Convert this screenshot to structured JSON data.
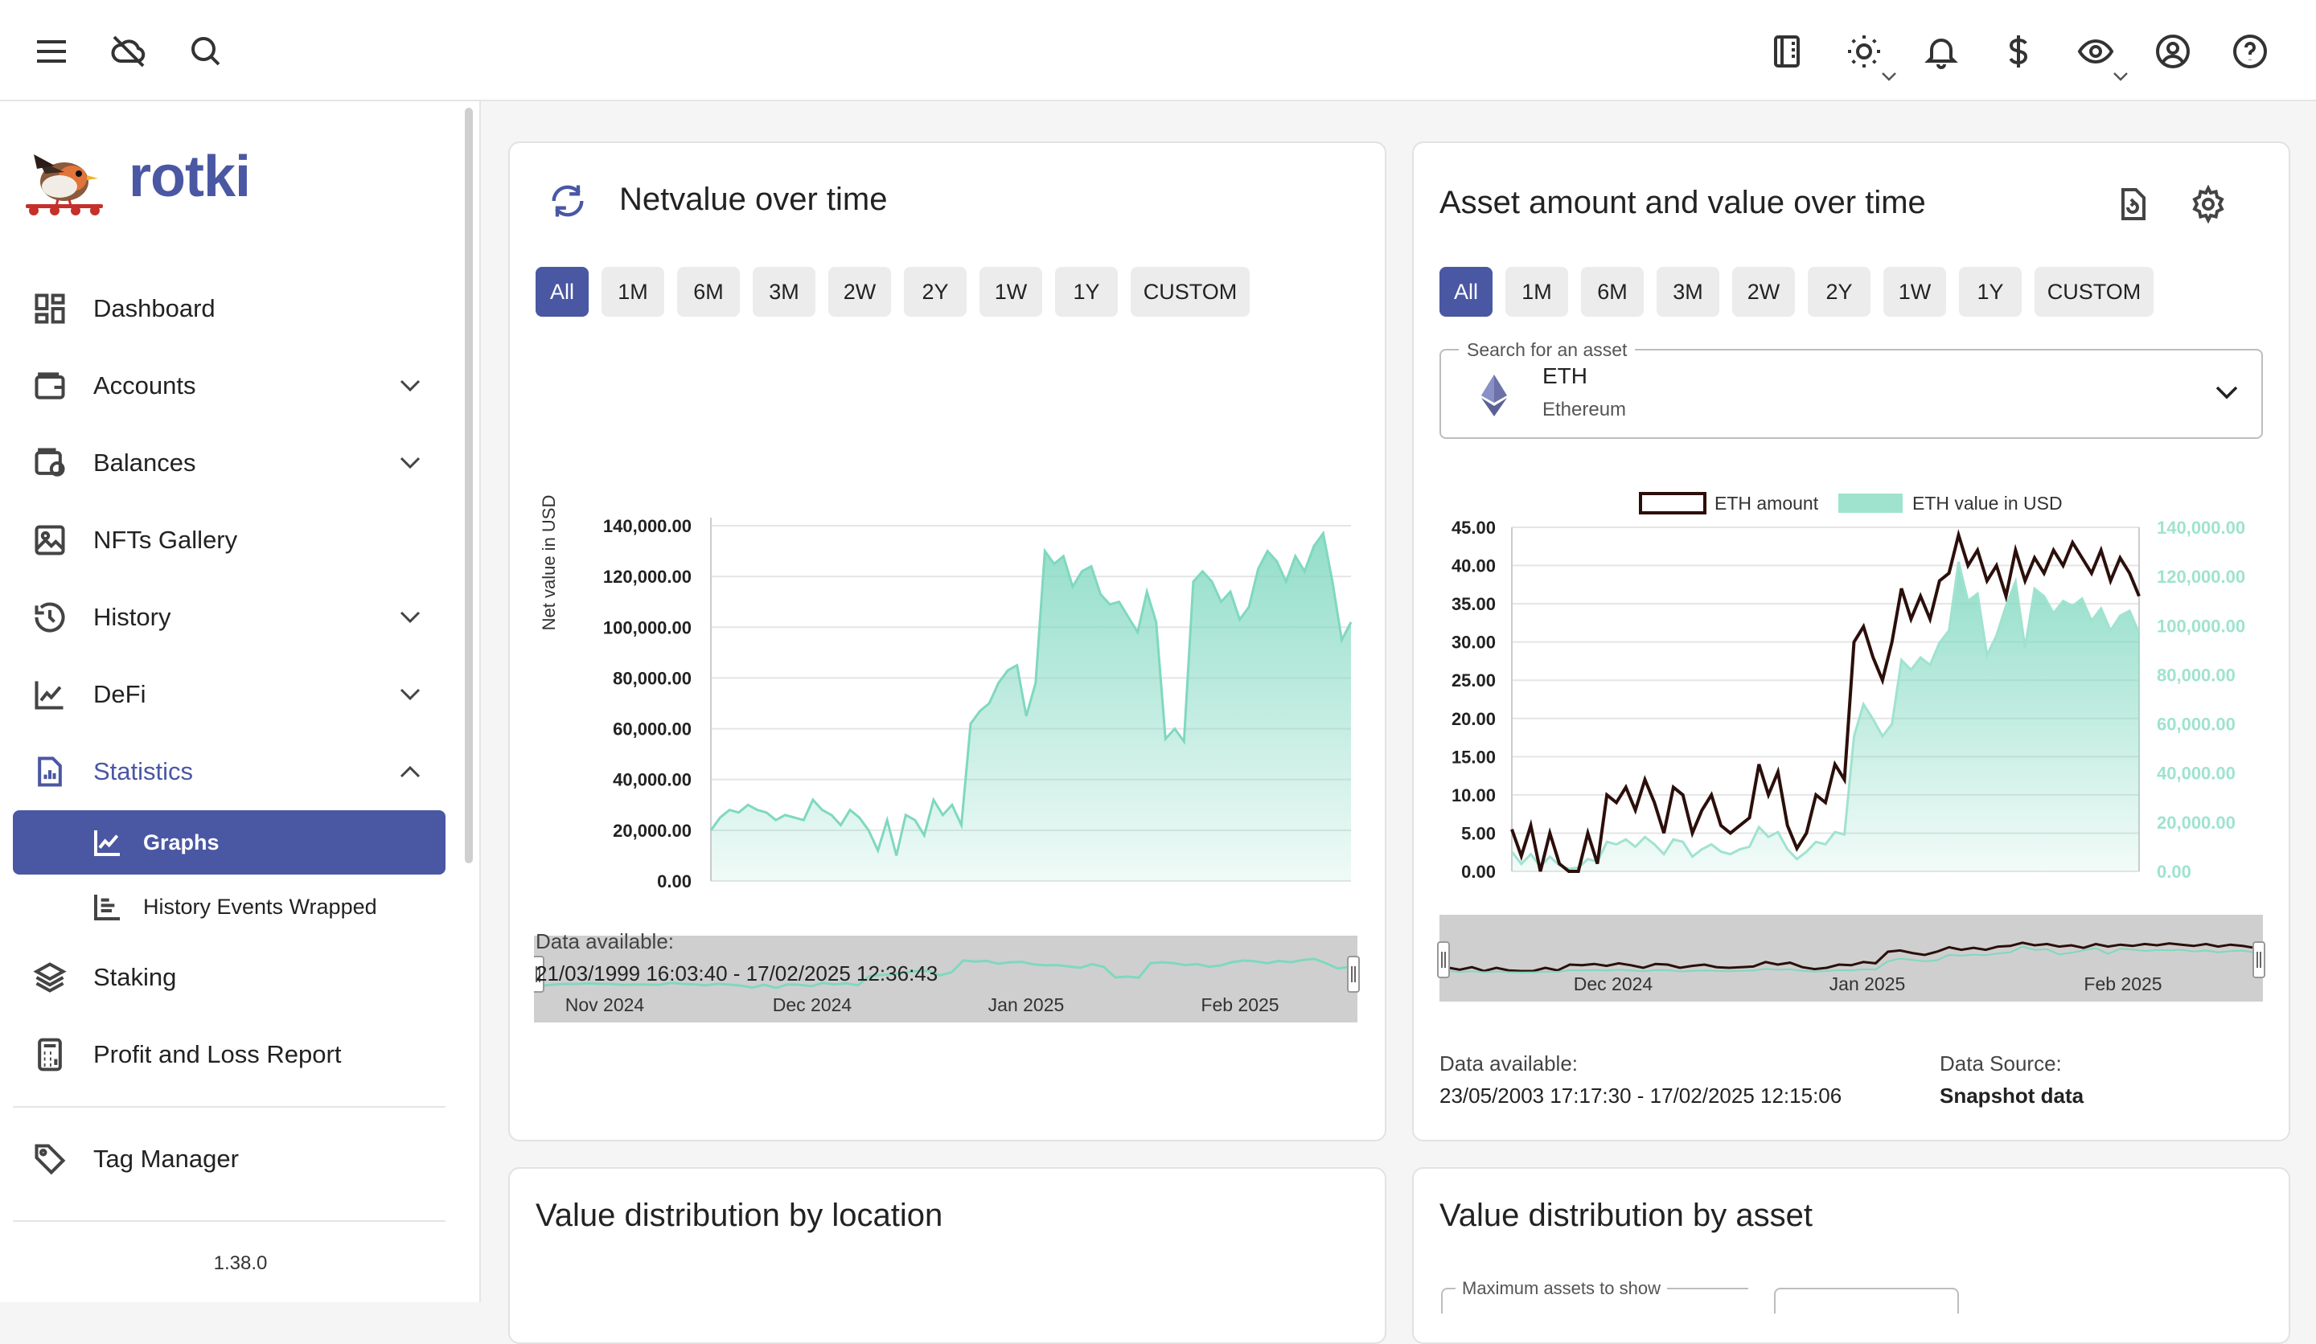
{
  "app": {
    "name": "rotki",
    "version": "1.38.0"
  },
  "topbar": {
    "left_icons": [
      "menu-icon",
      "cloud-off-icon",
      "search-icon"
    ],
    "right_icons": [
      "notes-icon",
      "theme-icon",
      "bell-icon",
      "currency-icon",
      "privacy-icon",
      "account-icon",
      "help-icon"
    ]
  },
  "sidebar": {
    "items": [
      {
        "label": "Dashboard",
        "icon": "dashboard-icon",
        "expandable": false
      },
      {
        "label": "Accounts",
        "icon": "wallet-icon",
        "expandable": true
      },
      {
        "label": "Balances",
        "icon": "balances-icon",
        "expandable": true
      },
      {
        "label": "NFTs Gallery",
        "icon": "image-icon",
        "expandable": false
      },
      {
        "label": "History",
        "icon": "history-icon",
        "expandable": true
      },
      {
        "label": "DeFi",
        "icon": "chart-line-icon",
        "expandable": true
      },
      {
        "label": "Statistics",
        "icon": "statistics-icon",
        "expandable": true,
        "expanded": true
      },
      {
        "label": "Staking",
        "icon": "layers-icon",
        "expandable": false
      },
      {
        "label": "Profit and Loss Report",
        "icon": "calculator-icon",
        "expandable": false
      },
      {
        "label": "Tag Manager",
        "icon": "tag-icon",
        "expandable": false
      }
    ],
    "sub_items": [
      {
        "label": "Graphs",
        "icon": "chart-line-icon",
        "active": true
      },
      {
        "label": "History Events Wrapped",
        "icon": "list-chart-icon",
        "active": false
      }
    ]
  },
  "netvalue_card": {
    "title": "Netvalue over time",
    "ranges": [
      "All",
      "1M",
      "6M",
      "3M",
      "2W",
      "2Y",
      "1W",
      "1Y",
      "CUSTOM"
    ],
    "active_range": "All",
    "data_available_label": "Data available:",
    "data_available_value": "21/03/1999 16:03:40 - 17/02/2025 12:36:43"
  },
  "asset_card": {
    "title": "Asset amount and value over time",
    "ranges": [
      "All",
      "1M",
      "6M",
      "3M",
      "2W",
      "2Y",
      "1W",
      "1Y",
      "CUSTOM"
    ],
    "active_range": "All",
    "search_label": "Search for an asset",
    "asset_symbol": "ETH",
    "asset_name": "Ethereum",
    "data_available_label": "Data available:",
    "data_available_value": "23/05/2003 17:17:30 - 17/02/2025 12:15:06",
    "data_source_label": "Data Source:",
    "data_source_value": "Snapshot data"
  },
  "location_card": {
    "title": "Value distribution by location"
  },
  "asset_dist_card": {
    "title": "Value distribution by asset",
    "max_assets_label": "Maximum assets to show"
  },
  "colors": {
    "primary": "#4a57a3",
    "teal": "#7fd8bf",
    "teal_light": "#9fe3cf",
    "dark_line": "#2b0f0a"
  },
  "chart_data": [
    {
      "type": "area",
      "title": "Netvalue over time",
      "ylabel": "Net value in USD",
      "ylim": [
        0,
        140000
      ],
      "yticks": [
        "140,000.00",
        "120,000.00",
        "100,000.00",
        "80,000.00",
        "60,000.00",
        "40,000.00",
        "20,000.00",
        "0.00"
      ],
      "zoom_labels": [
        "Nov 2024",
        "Dec 2024",
        "Jan 2025",
        "Feb 2025"
      ],
      "values": [
        20000,
        25000,
        28000,
        27000,
        30000,
        28000,
        27000,
        24000,
        26000,
        25000,
        24000,
        32000,
        28000,
        26000,
        22000,
        28000,
        25000,
        20000,
        12000,
        24000,
        10000,
        26000,
        24000,
        18000,
        32000,
        26000,
        30000,
        22000,
        62000,
        67000,
        70000,
        78000,
        83000,
        85000,
        65000,
        78000,
        130000,
        125000,
        128000,
        116000,
        122000,
        124000,
        113000,
        109000,
        110000,
        104000,
        98000,
        114000,
        102000,
        56000,
        60000,
        55000,
        118000,
        122000,
        118000,
        110000,
        114000,
        103000,
        108000,
        123000,
        130000,
        126000,
        118000,
        128000,
        122000,
        132000,
        137000,
        118000,
        95000,
        102000
      ],
      "grid": true,
      "legend": "none"
    },
    {
      "type": "line",
      "title": "Asset amount and value over time",
      "series": [
        {
          "name": "ETH amount",
          "axis": "left",
          "values": [
            5.5,
            2,
            6,
            0,
            5,
            1,
            0,
            0,
            5,
            1,
            10,
            9,
            11,
            8,
            12,
            9,
            5,
            11,
            10,
            5,
            8,
            10,
            6,
            5,
            6,
            7,
            14,
            10,
            13,
            6,
            3,
            5,
            10,
            9,
            14,
            12,
            30,
            32,
            28,
            25,
            30,
            37,
            33,
            36,
            33,
            38,
            39,
            44,
            40,
            42,
            38,
            40,
            36,
            42,
            38,
            41,
            39,
            42,
            40,
            43,
            41,
            39,
            42,
            38,
            41,
            39,
            36
          ]
        },
        {
          "name": "ETH value in USD",
          "axis": "right",
          "values": [
            8000,
            3000,
            7000,
            2000,
            6000,
            2500,
            1000,
            1500,
            5000,
            4000,
            12000,
            11000,
            13000,
            10000,
            14000,
            11000,
            7000,
            13000,
            12000,
            6000,
            9000,
            11000,
            8000,
            7000,
            9000,
            10000,
            18000,
            14000,
            16000,
            9000,
            5000,
            8000,
            12000,
            11000,
            16000,
            15000,
            55000,
            68000,
            62000,
            55000,
            60000,
            86000,
            82000,
            87000,
            84000,
            93000,
            98000,
            126000,
            110000,
            113000,
            88000,
            96000,
            108000,
            118000,
            91000,
            115000,
            112000,
            105000,
            110000,
            108000,
            111000,
            102000,
            107000,
            98000,
            104000,
            106000,
            97000
          ]
        }
      ],
      "ylim_left": [
        0,
        45
      ],
      "ylim_right": [
        0,
        140000
      ],
      "yticks_left": [
        "45.00",
        "40.00",
        "35.00",
        "30.00",
        "25.00",
        "20.00",
        "15.00",
        "10.00",
        "5.00",
        "0.00"
      ],
      "yticks_right": [
        "140,000.00",
        "120,000.00",
        "100,000.00",
        "80,000.00",
        "60,000.00",
        "40,000.00",
        "20,000.00",
        "0.00"
      ],
      "zoom_labels": [
        "Dec 2024",
        "Jan 2025",
        "Feb 2025"
      ],
      "grid": true,
      "legend": "top-center"
    }
  ]
}
